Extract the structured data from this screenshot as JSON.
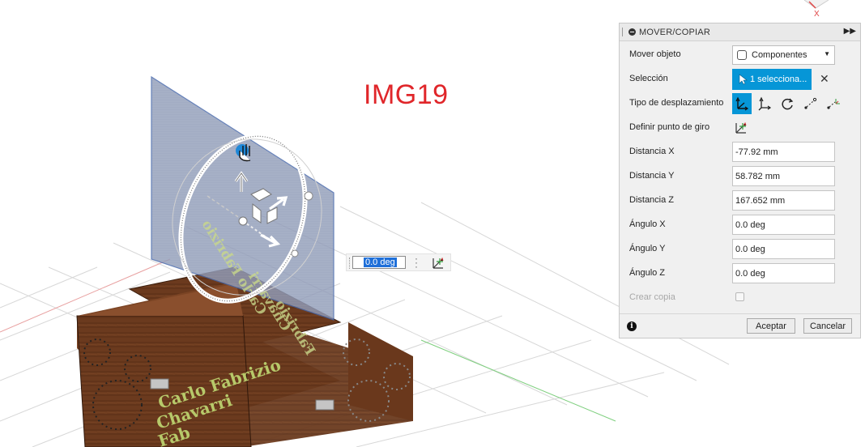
{
  "watermark": "IMG19",
  "inline_angle": {
    "value": "0.0 deg"
  },
  "dialog": {
    "title": "MOVER/COPIAR",
    "rows": {
      "move_object": {
        "label": "Mover objeto",
        "value": "Componentes"
      },
      "selection": {
        "label": "Selección",
        "value": "1 selecciona..."
      },
      "move_type": {
        "label": "Tipo de desplazamiento"
      },
      "pivot": {
        "label": "Definir punto de giro"
      },
      "dist_x": {
        "label": "Distancia X",
        "value": "-77.92 mm"
      },
      "dist_y": {
        "label": "Distancia Y",
        "value": "58.782 mm"
      },
      "dist_z": {
        "label": "Distancia Z",
        "value": "167.652 mm"
      },
      "angle_x": {
        "label": "Ángulo X",
        "value": "0.0 deg"
      },
      "angle_y": {
        "label": "Ángulo Y",
        "value": "0.0 deg"
      },
      "angle_z": {
        "label": "Ángulo Z",
        "value": "0.0 deg"
      },
      "create_copy": {
        "label": "Crear copia"
      }
    },
    "ok_label": "Aceptar",
    "cancel_label": "Cancelar"
  },
  "model": {
    "panel_text": [
      "Carlo Fabrizio",
      "Chavarri",
      "Fabrizio"
    ],
    "box_text": [
      "Carlo Fabrizio",
      "Chavarri",
      "Fab"
    ]
  },
  "view_cube": {
    "axis": "X"
  },
  "colors": {
    "accent": "#0696d7",
    "watermark": "#e0262a",
    "wood": "#6b3a1e",
    "panel": "#8f9bb8",
    "engrave_text": "#b7c96a"
  }
}
